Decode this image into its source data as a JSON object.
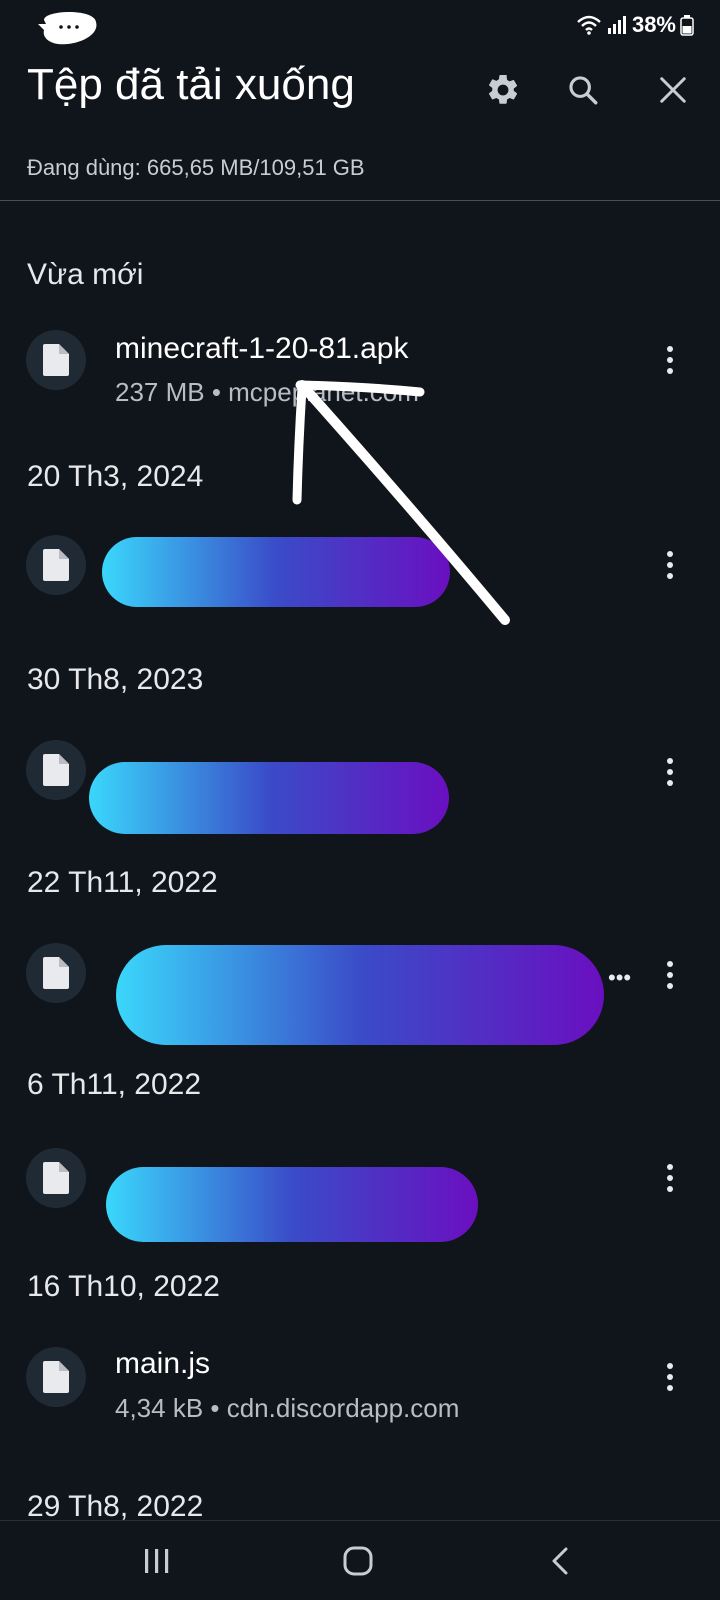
{
  "status_bar": {
    "battery": "38%"
  },
  "header": {
    "title": "Tệp đã tải xuống",
    "settings_icon": "gear-icon",
    "search_icon": "search-icon",
    "close_icon": "close-icon"
  },
  "storage": {
    "usage": "Đang dùng: 665,65 MB/109,51 GB"
  },
  "sections": [
    {
      "header": "Vừa mới",
      "files": [
        {
          "name": "minecraft-1-20-81.apk",
          "meta": "237 MB • mcpeplanet.com"
        }
      ]
    },
    {
      "header": "20 Th3, 2024"
    },
    {
      "header": "30 Th8, 2023"
    },
    {
      "header": "22 Th11, 2022"
    },
    {
      "header": "6 Th11, 2022"
    },
    {
      "header": "16 Th10, 2022",
      "files": [
        {
          "name": "main.js",
          "meta": "4,34 kB • cdn.discordapp.com"
        }
      ]
    },
    {
      "header": "29 Th8, 2022"
    }
  ],
  "colors": {
    "background": "#10141b",
    "icon_circle": "#1f2a35",
    "redaction_start": "#3ad7fb",
    "redaction_end": "#6a0fc0"
  }
}
